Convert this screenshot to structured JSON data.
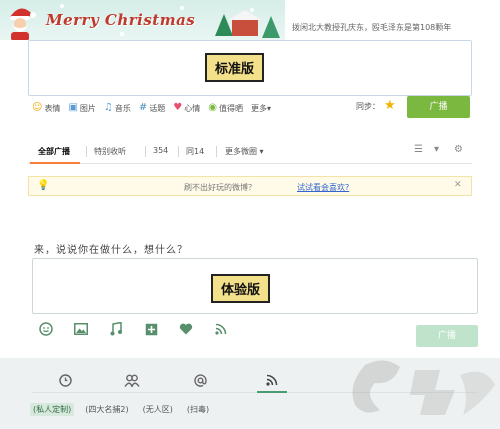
{
  "standard": {
    "banner_title": "Merry Christmas",
    "subtitle": "拨闲北大教授孔庆东，殴毛泽东是第108颗年",
    "version_label": "标准版",
    "toolbar": [
      {
        "icon": "smiley-icon",
        "glyph": "☺",
        "label": "表情"
      },
      {
        "icon": "image-icon",
        "glyph": "▣",
        "label": "图片"
      },
      {
        "icon": "music-icon",
        "glyph": "♫",
        "label": "音乐"
      },
      {
        "icon": "topic-icon",
        "glyph": "#",
        "label": "话题"
      },
      {
        "icon": "heart-icon",
        "glyph": "♥",
        "label": "心情"
      },
      {
        "icon": "vote-icon",
        "glyph": "◉",
        "label": "值得晒"
      },
      {
        "icon": "more-icon",
        "glyph": "",
        "label": "更多▾"
      }
    ],
    "sync_label": "同步：",
    "publish_label": "广播",
    "tabs": {
      "all": "全部广播",
      "special": "特别收听",
      "t354": "354",
      "t14": "同14",
      "more": "更多微圈 ▾"
    },
    "tip_text": "刷不出好玩的微博？",
    "tip_link": "试试看会喜欢?"
  },
  "experience": {
    "prompt": "来，说说你在做什么，想什么？",
    "version_label": "体验版",
    "publish_label": "广播",
    "groups": [
      {
        "label": "(私人定制)",
        "active": true
      },
      {
        "label": "(四大名捕2)",
        "active": false
      },
      {
        "label": "(无人区)",
        "active": false
      },
      {
        "label": "(扫毒)",
        "active": false
      }
    ]
  },
  "colors": {
    "accent_green": "#7ab83f",
    "tab_active_orange": "#fa7d3c",
    "label_yellow": "#f3e08a",
    "exp_green": "#4a9d6f"
  }
}
